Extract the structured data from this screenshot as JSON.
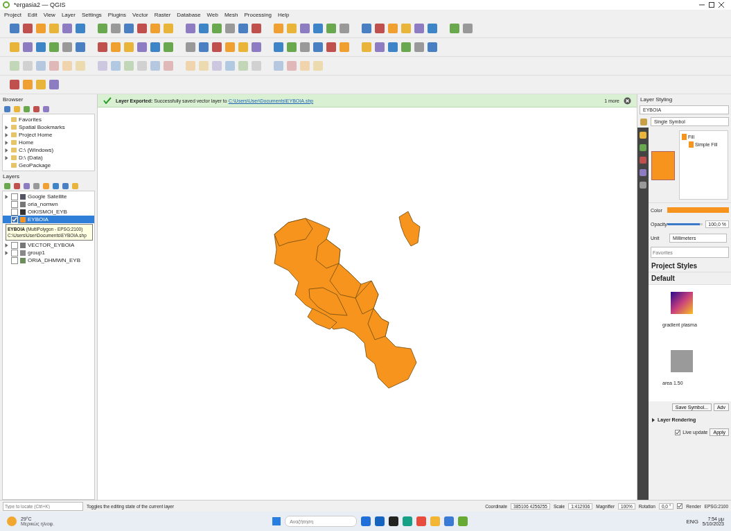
{
  "window": {
    "title": "*ergasia2 — QGIS"
  },
  "menu": [
    "Project",
    "Edit",
    "View",
    "Layer",
    "Settings",
    "Plugins",
    "Vector",
    "Raster",
    "Database",
    "Web",
    "Mesh",
    "Processing",
    "Help"
  ],
  "browser": {
    "title": "Browser",
    "items": [
      {
        "label": "Favorites"
      },
      {
        "label": "Spatial Bookmarks",
        "expanded": false
      },
      {
        "label": "Project Home",
        "expanded": false
      },
      {
        "label": "Home",
        "expanded": false
      },
      {
        "label": "C:\\ (Windows)",
        "expanded": false
      },
      {
        "label": "D:\\ (Data)",
        "expanded": false
      },
      {
        "label": "GeoPackage"
      }
    ]
  },
  "layers": {
    "title": "Layers",
    "items": [
      {
        "label": "Google Satellite",
        "kind": "raster",
        "checked": false,
        "selected": false,
        "expanded": false
      },
      {
        "label": "oria_nomwn",
        "kind": "line",
        "checked": false,
        "selected": false
      },
      {
        "label": "OIKISMOI_EYB",
        "kind": "point",
        "checked": false,
        "selected": false
      },
      {
        "label": "EYBOIA",
        "kind": "polygon",
        "checked": true,
        "selected": true
      },
      {
        "label": "VECTOR_EYBOIA",
        "kind": "line",
        "checked": false,
        "selected": false,
        "expanded": false
      },
      {
        "label": "group1",
        "kind": "group",
        "checked": false,
        "selected": false,
        "expanded": false
      },
      {
        "label": "ORIA_DHMWN_EYB",
        "kind": "polygon-grey",
        "checked": false,
        "selected": false
      }
    ],
    "tooltip": {
      "title": "EYBOIA",
      "text": " (MultiPolygon - EPSG:2100)",
      "path": "C:\\Users\\User\\Documents\\EYBOIA.shp"
    }
  },
  "message_bar": {
    "title": "Layer Exported:",
    "text": "Successfully saved vector layer to",
    "link": "C:\\Users\\User\\Documents\\EYBOIA.shp",
    "more": "1 more"
  },
  "styling": {
    "title": "Layer Styling",
    "layer": "EYBOIA",
    "renderer": "Single Symbol",
    "tree": [
      "Fill",
      "Simple Fill"
    ],
    "color_label": "Color",
    "opacity_label": "Opacity",
    "opacity": {
      "level": 0.92,
      "reading": "100,0 %"
    },
    "unit_label": "Unit",
    "unit": "Millimeters",
    "search": {
      "placeholder": "Favorites"
    },
    "groups": [
      "Project Styles",
      "Default"
    ],
    "styles": [
      {
        "name": "gradient plasma",
        "kind": "gradient"
      },
      {
        "name": "area 1.50",
        "kind": "grey"
      }
    ],
    "save": "Save Symbol...",
    "advanced": "Adv",
    "rendering": {
      "label": "Layer Rendering",
      "expanded": false
    },
    "live_update": {
      "label": "Live update",
      "checked": true
    },
    "apply": "Apply"
  },
  "status_bar": {
    "locator": {
      "placeholder": "Type to locate (Ctrl+K)"
    },
    "message": "Toggles the editing state of the current layer",
    "coordinate_label": "Coordinate",
    "coordinate": "385106 4256255",
    "scale_label": "Scale",
    "scale": "1:412936",
    "magnifier_label": "Magnifier",
    "magnifier": "100%",
    "rotation_label": "Rotation",
    "rotation": "0,0 °",
    "render": {
      "label": "Render",
      "checked": true
    },
    "crs": "EPSG:2100"
  },
  "taskbar": {
    "temp": "29°C",
    "weather": "Μερικώς ηλιοφ.",
    "search": {
      "placeholder": "Αναζήτηση"
    },
    "lang": "ENG",
    "time": "7:54 μμ",
    "date": "5/10/2023"
  }
}
